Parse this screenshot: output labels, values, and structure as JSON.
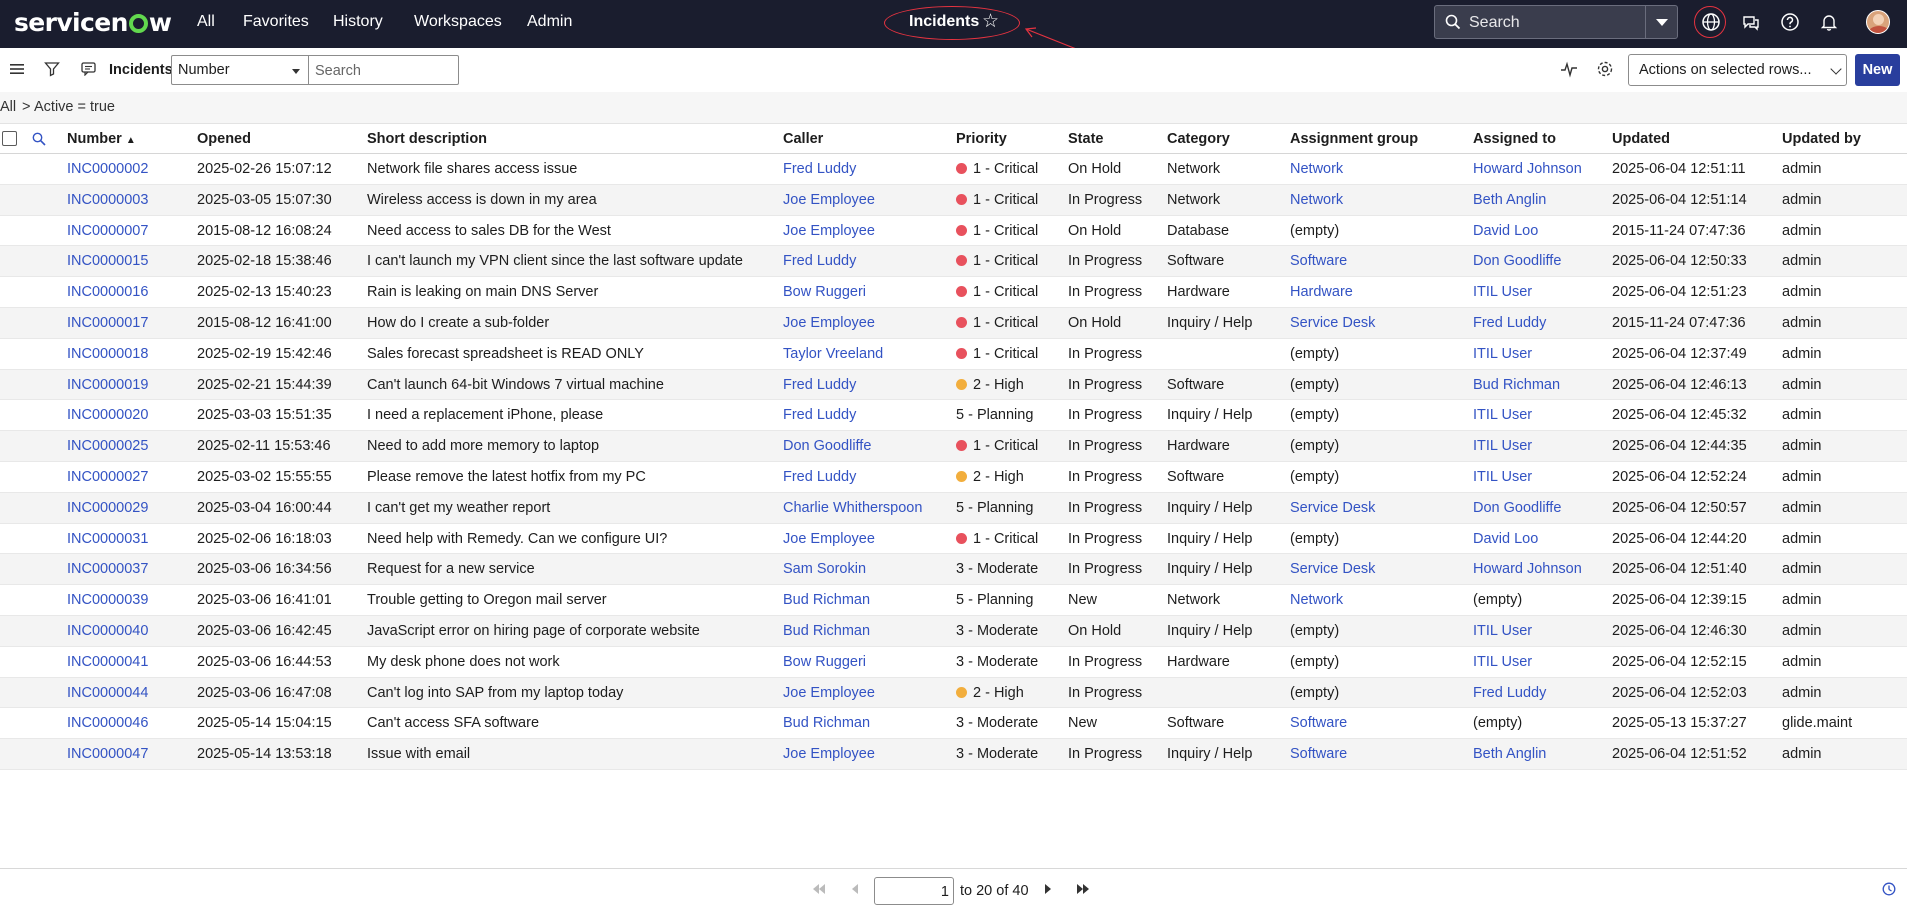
{
  "app": {
    "logo": "servicenow",
    "nav": [
      "All",
      "Favorites",
      "History",
      "Workspaces",
      "Admin"
    ],
    "context_title": "Incidents",
    "search_placeholder": "Search"
  },
  "toolbar": {
    "title": "Incidents",
    "field_select": "Number",
    "search_placeholder": "Search",
    "actions": "Actions on selected rows...",
    "new_label": "New"
  },
  "breadcrumb": {
    "all": "All",
    "sep": ">",
    "filter": "Active = true"
  },
  "colors": {
    "critical": "#e8515d",
    "high": "#f2ae3d",
    "link": "#3353c4",
    "nav_bg": "#1a1d2e",
    "primary_button": "#293e9d"
  },
  "table": {
    "columns": [
      "Number",
      "Opened",
      "Short description",
      "Caller",
      "Priority",
      "State",
      "Category",
      "Assignment group",
      "Assigned to",
      "Updated",
      "Updated by"
    ],
    "sorted_column": "Number",
    "rows": [
      {
        "number": "INC0000002",
        "opened": "2025-02-26 15:07:12",
        "desc": "Network file shares access issue",
        "caller": "Fred Luddy",
        "priority": "1 - Critical",
        "state": "On Hold",
        "category": "Network",
        "group": "Network",
        "assigned": "Howard Johnson",
        "updated": "2025-06-04 12:51:11",
        "by": "admin"
      },
      {
        "number": "INC0000003",
        "opened": "2025-03-05 15:07:30",
        "desc": "Wireless access is down in my area",
        "caller": "Joe Employee",
        "priority": "1 - Critical",
        "state": "In Progress",
        "category": "Network",
        "group": "Network",
        "assigned": "Beth Anglin",
        "updated": "2025-06-04 12:51:14",
        "by": "admin"
      },
      {
        "number": "INC0000007",
        "opened": "2015-08-12 16:08:24",
        "desc": "Need access to sales DB for the West",
        "caller": "Joe Employee",
        "priority": "1 - Critical",
        "state": "On Hold",
        "category": "Database",
        "group": "(empty)",
        "assigned": "David Loo",
        "updated": "2015-11-24 07:47:36",
        "by": "admin"
      },
      {
        "number": "INC0000015",
        "opened": "2025-02-18 15:38:46",
        "desc": "I can't launch my VPN client since the last software update",
        "caller": "Fred Luddy",
        "priority": "1 - Critical",
        "state": "In Progress",
        "category": "Software",
        "group": "Software",
        "assigned": "Don Goodliffe",
        "updated": "2025-06-04 12:50:33",
        "by": "admin"
      },
      {
        "number": "INC0000016",
        "opened": "2025-02-13 15:40:23",
        "desc": "Rain is leaking on main DNS Server",
        "caller": "Bow Ruggeri",
        "priority": "1 - Critical",
        "state": "In Progress",
        "category": "Hardware",
        "group": "Hardware",
        "assigned": "ITIL User",
        "updated": "2025-06-04 12:51:23",
        "by": "admin"
      },
      {
        "number": "INC0000017",
        "opened": "2015-08-12 16:41:00",
        "desc": "How do I create a sub-folder",
        "caller": "Joe Employee",
        "priority": "1 - Critical",
        "state": "On Hold",
        "category": "Inquiry / Help",
        "group": "Service Desk",
        "assigned": "Fred Luddy",
        "updated": "2015-11-24 07:47:36",
        "by": "admin"
      },
      {
        "number": "INC0000018",
        "opened": "2025-02-19 15:42:46",
        "desc": "Sales forecast spreadsheet is READ ONLY",
        "caller": "Taylor Vreeland",
        "priority": "1 - Critical",
        "state": "In Progress",
        "category": "",
        "group": "(empty)",
        "assigned": "ITIL User",
        "updated": "2025-06-04 12:37:49",
        "by": "admin"
      },
      {
        "number": "INC0000019",
        "opened": "2025-02-21 15:44:39",
        "desc": "Can't launch 64-bit Windows 7 virtual machine",
        "caller": "Fred Luddy",
        "priority": "2 - High",
        "state": "In Progress",
        "category": "Software",
        "group": "(empty)",
        "assigned": "Bud Richman",
        "updated": "2025-06-04 12:46:13",
        "by": "admin"
      },
      {
        "number": "INC0000020",
        "opened": "2025-03-03 15:51:35",
        "desc": "I need a replacement iPhone, please",
        "caller": "Fred Luddy",
        "priority": "5 - Planning",
        "state": "In Progress",
        "category": "Inquiry / Help",
        "group": "(empty)",
        "assigned": "ITIL User",
        "updated": "2025-06-04 12:45:32",
        "by": "admin"
      },
      {
        "number": "INC0000025",
        "opened": "2025-02-11 15:53:46",
        "desc": "Need to add more memory to laptop",
        "caller": "Don Goodliffe",
        "priority": "1 - Critical",
        "state": "In Progress",
        "category": "Hardware",
        "group": "(empty)",
        "assigned": "ITIL User",
        "updated": "2025-06-04 12:44:35",
        "by": "admin"
      },
      {
        "number": "INC0000027",
        "opened": "2025-03-02 15:55:55",
        "desc": "Please remove the latest hotfix from my PC",
        "caller": "Fred Luddy",
        "priority": "2 - High",
        "state": "In Progress",
        "category": "Software",
        "group": "(empty)",
        "assigned": "ITIL User",
        "updated": "2025-06-04 12:52:24",
        "by": "admin"
      },
      {
        "number": "INC0000029",
        "opened": "2025-03-04 16:00:44",
        "desc": "I can't get my weather report",
        "caller": "Charlie Whitherspoon",
        "priority": "5 - Planning",
        "state": "In Progress",
        "category": "Inquiry / Help",
        "group": "Service Desk",
        "assigned": "Don Goodliffe",
        "updated": "2025-06-04 12:50:57",
        "by": "admin"
      },
      {
        "number": "INC0000031",
        "opened": "2025-02-06 16:18:03",
        "desc": "Need help with Remedy. Can we configure UI?",
        "caller": "Joe Employee",
        "priority": "1 - Critical",
        "state": "In Progress",
        "category": "Inquiry / Help",
        "group": "(empty)",
        "assigned": "David Loo",
        "updated": "2025-06-04 12:44:20",
        "by": "admin"
      },
      {
        "number": "INC0000037",
        "opened": "2025-03-06 16:34:56",
        "desc": "Request for a new service",
        "caller": "Sam Sorokin",
        "priority": "3 - Moderate",
        "state": "In Progress",
        "category": "Inquiry / Help",
        "group": "Service Desk",
        "assigned": "Howard Johnson",
        "updated": "2025-06-04 12:51:40",
        "by": "admin"
      },
      {
        "number": "INC0000039",
        "opened": "2025-03-06 16:41:01",
        "desc": "Trouble getting to Oregon mail server",
        "caller": "Bud Richman",
        "priority": "5 - Planning",
        "state": "New",
        "category": "Network",
        "group": "Network",
        "assigned": "(empty)",
        "updated": "2025-06-04 12:39:15",
        "by": "admin"
      },
      {
        "number": "INC0000040",
        "opened": "2025-03-06 16:42:45",
        "desc": "JavaScript error on hiring page of corporate website",
        "caller": "Bud Richman",
        "priority": "3 - Moderate",
        "state": "On Hold",
        "category": "Inquiry / Help",
        "group": "(empty)",
        "assigned": "ITIL User",
        "updated": "2025-06-04 12:46:30",
        "by": "admin"
      },
      {
        "number": "INC0000041",
        "opened": "2025-03-06 16:44:53",
        "desc": "My desk phone does not work",
        "caller": "Bow Ruggeri",
        "priority": "3 - Moderate",
        "state": "In Progress",
        "category": "Hardware",
        "group": "(empty)",
        "assigned": "ITIL User",
        "updated": "2025-06-04 12:52:15",
        "by": "admin"
      },
      {
        "number": "INC0000044",
        "opened": "2025-03-06 16:47:08",
        "desc": "Can't log into SAP from my laptop today",
        "caller": "Joe Employee",
        "priority": "2 - High",
        "state": "In Progress",
        "category": "",
        "group": "(empty)",
        "assigned": "Fred Luddy",
        "updated": "2025-06-04 12:52:03",
        "by": "admin"
      },
      {
        "number": "INC0000046",
        "opened": "2025-05-14 15:04:15",
        "desc": "Can't access SFA software",
        "caller": "Bud Richman",
        "priority": "3 - Moderate",
        "state": "New",
        "category": "Software",
        "group": "Software",
        "assigned": "(empty)",
        "updated": "2025-05-13 15:37:27",
        "by": "glide.maint"
      },
      {
        "number": "INC0000047",
        "opened": "2025-05-14 13:53:18",
        "desc": "Issue with email",
        "caller": "Joe Employee",
        "priority": "3 - Moderate",
        "state": "In Progress",
        "category": "Inquiry / Help",
        "group": "Software",
        "assigned": "Beth Anglin",
        "updated": "2025-06-04 12:51:52",
        "by": "admin"
      }
    ]
  },
  "pager": {
    "page": "1",
    "range": "to 20 of 40"
  }
}
